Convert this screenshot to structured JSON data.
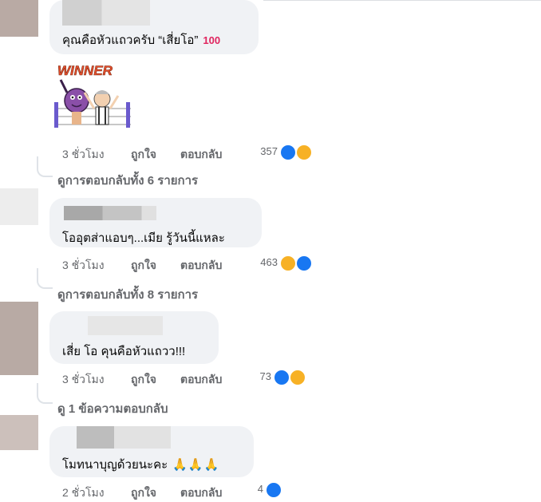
{
  "colors": {
    "bubble": "#f0f2f5",
    "meta_text": "#65676b",
    "like_blue": "#1877f2",
    "haha_yellow": "#f7b125"
  },
  "comments": [
    {
      "text": "คุณคือหัวแถวครับ “เสี่ยโอ”",
      "emoji": "💯",
      "sticker_text": "WINNER",
      "time": "3 ชั่วโมง",
      "like_label": "ถูกใจ",
      "reply_label": "ตอบกลับ",
      "reactions": [
        "like-icon",
        "haha-icon"
      ],
      "reaction_count": "357",
      "view_replies": "ดูการตอบกลับทั้ง 6 รายการ"
    },
    {
      "text": "โออุตส่าแอบๆ...เมีย รู้วันนี้แหละ",
      "time": "3 ชั่วโมง",
      "like_label": "ถูกใจ",
      "reply_label": "ตอบกลับ",
      "reactions": [
        "haha-icon",
        "like-icon"
      ],
      "reaction_count": "463",
      "view_replies": "ดูการตอบกลับทั้ง 8 รายการ"
    },
    {
      "text": "เสี่ย โอ คุนคือหัวแถวว!!!",
      "time": "3 ชั่วโมง",
      "like_label": "ถูกใจ",
      "reply_label": "ตอบกลับ",
      "reactions": [
        "like-icon",
        "haha-icon"
      ],
      "reaction_count": "73",
      "view_replies": "ดู 1 ข้อความตอบกลับ"
    },
    {
      "text": "โมทนาบุญด้วยนะคะ",
      "emoji": "🙏🙏🙏",
      "time": "2 ชั่วโมง",
      "like_label": "ถูกใจ",
      "reply_label": "ตอบกลับ",
      "reactions": [
        "like-icon"
      ],
      "reaction_count": "4"
    }
  ]
}
